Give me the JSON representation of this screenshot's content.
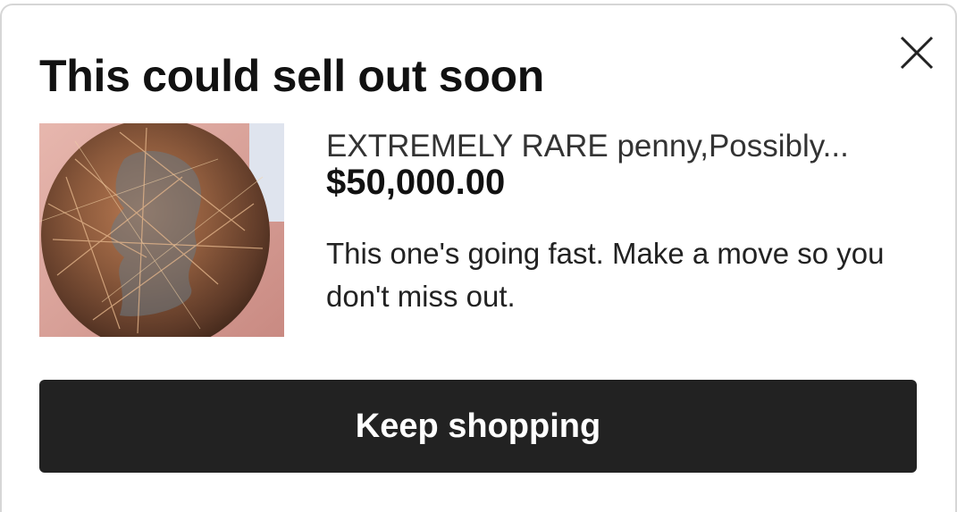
{
  "dialog": {
    "title": "This could sell out soon",
    "close_icon": "close-icon"
  },
  "listing": {
    "title": "EXTREMELY RARE penny,Possibly...",
    "price": "$50,000.00",
    "image_icon": "coin-photo",
    "message": "This one's going fast. Make a move so you don't miss out."
  },
  "actions": {
    "keep_shopping_label": "Keep shopping"
  },
  "colors": {
    "button_bg": "#222222",
    "button_text": "#ffffff",
    "text_primary": "#111111",
    "text_secondary": "#333333",
    "border": "#d6d6d6"
  }
}
